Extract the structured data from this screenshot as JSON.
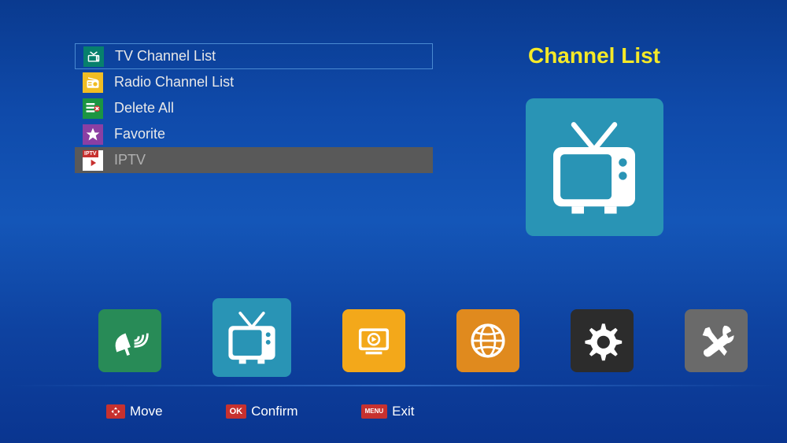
{
  "title": "Channel List",
  "menu": {
    "items": [
      {
        "label": "TV Channel List"
      },
      {
        "label": "Radio Channel List"
      },
      {
        "label": "Delete All"
      },
      {
        "label": "Favorite"
      },
      {
        "label": "IPTV"
      }
    ]
  },
  "hints": {
    "move": {
      "badge": "dpad",
      "label": "Move"
    },
    "confirm": {
      "badge": "OK",
      "label": "Confirm"
    },
    "exit": {
      "badge": "MENU",
      "label": "Exit"
    }
  }
}
